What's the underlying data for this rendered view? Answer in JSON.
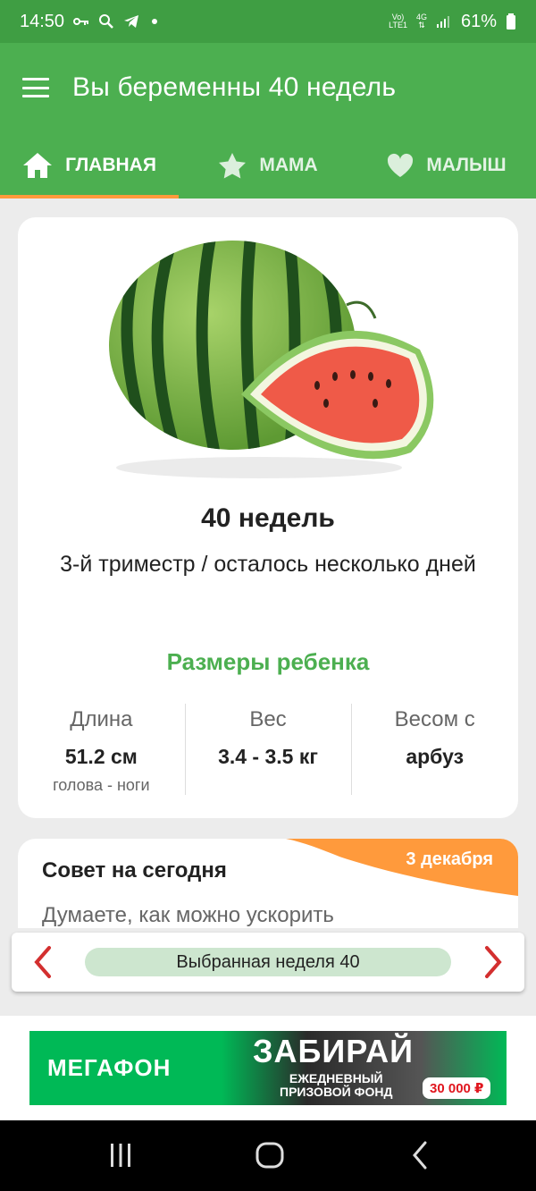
{
  "status_bar": {
    "time": "14:50",
    "network_top": "Vo)",
    "network_bottom": "LTE1",
    "data_type": "4G",
    "battery": "61%"
  },
  "app_bar": {
    "title": "Вы беременны 40 недель"
  },
  "tabs": [
    {
      "label": "ГЛАВНАЯ",
      "icon": "home-icon",
      "active": true
    },
    {
      "label": "МАМА",
      "icon": "star-icon",
      "active": false
    },
    {
      "label": "МАЛЫШ",
      "icon": "heart-icon",
      "active": false
    }
  ],
  "week_card": {
    "image": "watermelon",
    "title": "40 недель",
    "subtitle": "3-й триместр / осталось несколько дней",
    "sizes_title": "Размеры ребенка",
    "stats": [
      {
        "label": "Длина",
        "value": "51.2 см",
        "note": "голова - ноги"
      },
      {
        "label": "Вес",
        "value": "3.4 - 3.5 кг",
        "note": ""
      },
      {
        "label": "Весом с",
        "value": "арбуз",
        "note": ""
      }
    ]
  },
  "tip_card": {
    "title": "Совет на сегодня",
    "date": "3 декабря",
    "text": "Думаете, как можно ускорить"
  },
  "week_selector": {
    "label": "Выбранная неделя 40"
  },
  "ad": {
    "brand": "МЕГАФОН",
    "headline": "ЗАБИРАЙ",
    "sub_line1": "ЕЖЕДНЕВНЫЙ",
    "sub_line2": "ПРИЗОВОЙ ФОНД",
    "amount": "30 000 ₽"
  },
  "colors": {
    "primary": "#4caf50",
    "status": "#3f9e43",
    "accent": "#ff9a3c",
    "arrow": "#d32f2f"
  }
}
